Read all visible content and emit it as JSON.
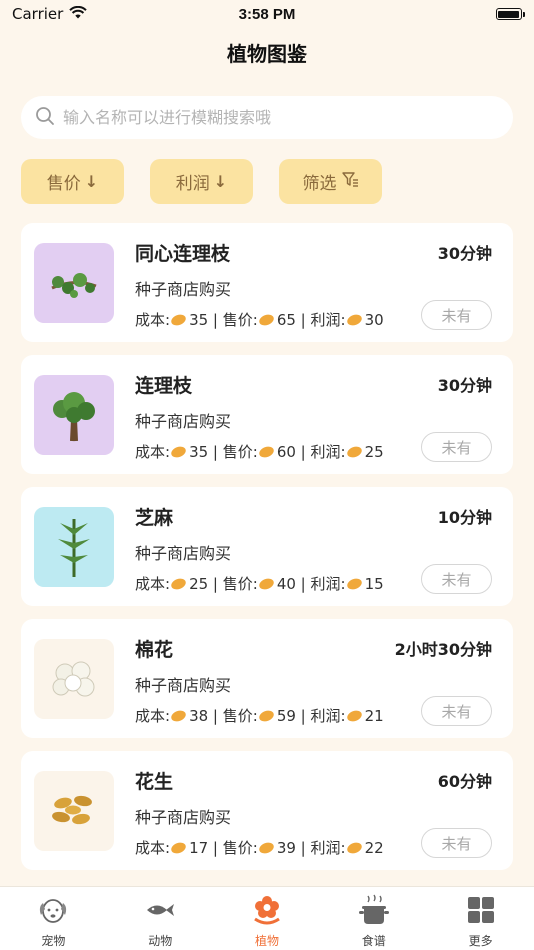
{
  "status_bar": {
    "carrier": "Carrier",
    "time": "3:58 PM"
  },
  "page": {
    "title": "植物图鉴"
  },
  "search": {
    "placeholder": "输入名称可以进行模糊搜索哦"
  },
  "filters": [
    {
      "label": "售价"
    },
    {
      "label": "利润"
    },
    {
      "label": "筛选"
    }
  ],
  "plants": [
    {
      "name": "同心连理枝",
      "duration": "30分钟",
      "source": "种子商店购买",
      "cost_label": "成本:",
      "cost": "35",
      "price_label": "售价:",
      "price": "65",
      "profit_label": "利润:",
      "profit": "30",
      "owned": "未有",
      "thumb_bg": "#e2cef2"
    },
    {
      "name": "连理枝",
      "duration": "30分钟",
      "source": "种子商店购买",
      "cost_label": "成本:",
      "cost": "35",
      "price_label": "售价:",
      "price": "60",
      "profit_label": "利润:",
      "profit": "25",
      "owned": "未有",
      "thumb_bg": "#e2cef2"
    },
    {
      "name": "芝麻",
      "duration": "10分钟",
      "source": "种子商店购买",
      "cost_label": "成本:",
      "cost": "25",
      "price_label": "售价:",
      "price": "40",
      "profit_label": "利润:",
      "profit": "15",
      "owned": "未有",
      "thumb_bg": "#bdeaf2"
    },
    {
      "name": "棉花",
      "duration": "2小时30分钟",
      "source": "种子商店购买",
      "cost_label": "成本:",
      "cost": "38",
      "price_label": "售价:",
      "price": "59",
      "profit_label": "利润:",
      "profit": "21",
      "owned": "未有",
      "thumb_bg": "#fbf4ea"
    },
    {
      "name": "花生",
      "duration": "60分钟",
      "source": "种子商店购买",
      "cost_label": "成本:",
      "cost": "17",
      "price_label": "售价:",
      "price": "39",
      "profit_label": "利润:",
      "profit": "22",
      "owned": "未有",
      "thumb_bg": "#fbf4ea"
    }
  ],
  "tabbar": [
    {
      "label": "宠物",
      "icon": "dog-icon"
    },
    {
      "label": "动物",
      "icon": "fish-icon"
    },
    {
      "label": "植物",
      "icon": "flower-icon",
      "active": true
    },
    {
      "label": "食谱",
      "icon": "pot-icon"
    },
    {
      "label": "更多",
      "icon": "grid-icon"
    }
  ],
  "colors": {
    "accent": "#f07038",
    "filter_bg": "#fbe3a1",
    "filter_text": "#8a6a3c",
    "page_bg": "#fdf6ec"
  }
}
